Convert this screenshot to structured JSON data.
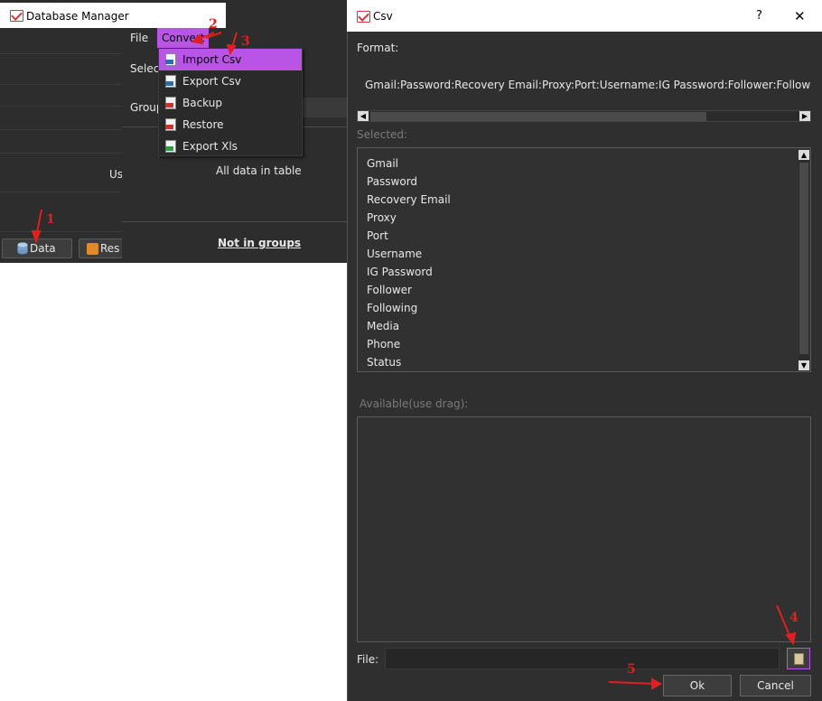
{
  "background_app": {
    "partial_label_us": "Us",
    "data_button": "Data",
    "reset_button": "Res"
  },
  "db_manager": {
    "title": "Database Manager",
    "menu": {
      "file": "File",
      "convert": "Convert"
    },
    "convert_menu": [
      {
        "label": "Import Csv",
        "icon": "csv-file-icon",
        "tag_color": "#2a6fb0"
      },
      {
        "label": "Export Csv",
        "icon": "csv-file-icon",
        "tag_color": "#2a6fb0"
      },
      {
        "label": "Backup",
        "icon": "sql-file-icon",
        "tag_color": "#c0392b"
      },
      {
        "label": "Restore",
        "icon": "sql-file-icon",
        "tag_color": "#c0392b"
      },
      {
        "label": "Export Xls",
        "icon": "xls-file-icon",
        "tag_color": "#2e9e3e"
      }
    ],
    "select_label": "Selec",
    "group_label": "Group",
    "all_data": "All data in table",
    "not_in_groups": "Not in groups"
  },
  "csv_dialog": {
    "title": "Csv",
    "help": "?",
    "close": "✕",
    "format_label": "Format:",
    "format_value": "Gmail:Password:Recovery Email:Proxy:Port:Username:IG Password:Follower:Following",
    "selected_label": "Selected:",
    "selected_items": [
      "Gmail",
      "Password",
      "Recovery Email",
      "Proxy",
      "Port",
      "Username",
      "IG Password",
      "Follower",
      "Following",
      "Media",
      "Phone",
      "Status"
    ],
    "available_label": "Available(use drag):",
    "file_label": "File:",
    "file_value": "",
    "ok_button": "Ok",
    "cancel_button": "Cancel"
  },
  "annotations": [
    "1",
    "2",
    "3",
    "4",
    "5"
  ],
  "colors": {
    "accent": "#b855e6",
    "annotation": "#e02020",
    "panel": "#2f2f2f"
  }
}
